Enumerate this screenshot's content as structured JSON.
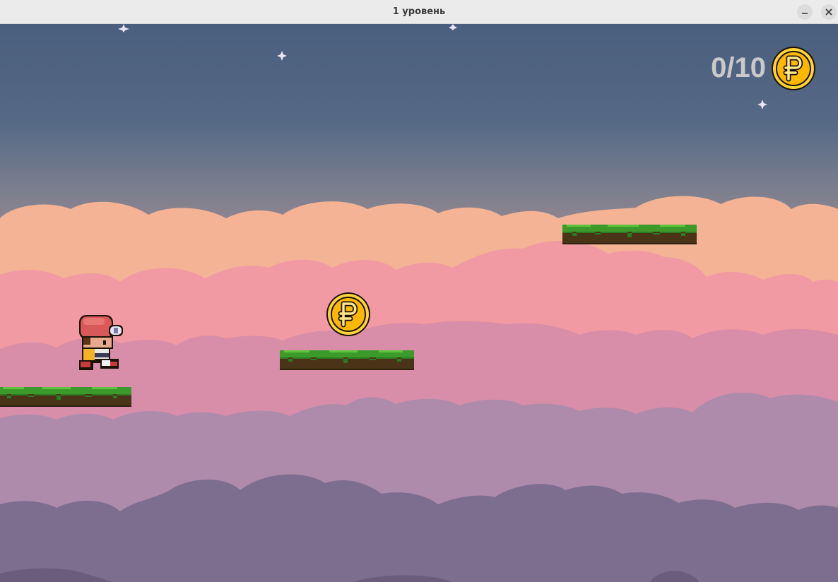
{
  "window": {
    "title": "1 уровень",
    "minimize_glyph": "–",
    "close_glyph": "✕"
  },
  "hud": {
    "coins_collected": 0,
    "coins_total": 10,
    "counter_text": "0/10",
    "coin_symbol": "₽",
    "coin_icon": "ruble-coin-icon"
  },
  "colors": {
    "sky_top": "#4a5e7e",
    "sky_mid": "#8a7f8a",
    "cloud_peach": "#f3b394",
    "cloud_pink": "#f29aa3",
    "cloud_mauve": "#d88ea8",
    "cloud_lilac": "#ae8aab",
    "cloud_purple": "#7d6e8f",
    "grass": "#3c9a2a",
    "soil": "#4a3418",
    "coin_gold": "#ffc21c",
    "counter_text": "#c9c9c9"
  },
  "scene": {
    "platforms": [
      "grass-platform",
      "grass-platform",
      "grass-platform"
    ],
    "coins": [
      "ruble-coin"
    ],
    "player": "player-character-red-cap"
  }
}
